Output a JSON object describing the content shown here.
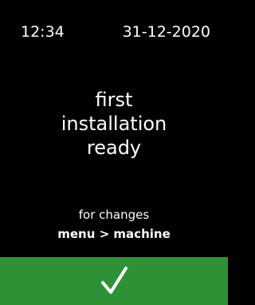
{
  "status_bar": {
    "time": "12:34",
    "date": "31-12-2020"
  },
  "message": {
    "lines": [
      "first",
      "installation",
      "ready"
    ]
  },
  "hint": {
    "line1": "for changes",
    "path": "menu > machine"
  },
  "confirm_button": {
    "icon": "checkmark-icon",
    "color": "#2e9135"
  },
  "colors": {
    "background": "#000000",
    "text": "#ffffff",
    "accent": "#2e9135"
  }
}
